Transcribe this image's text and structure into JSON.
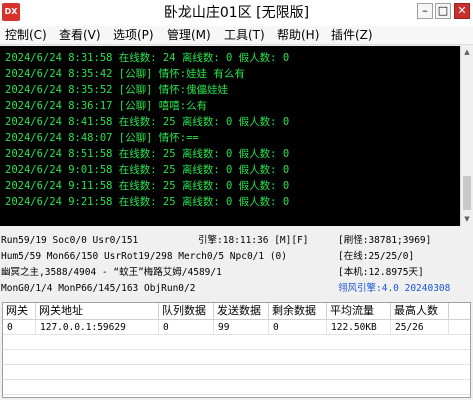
{
  "window": {
    "title": "卧龙山庄01区 [无限版]",
    "icon_label": "DX",
    "min_glyph": "–",
    "max_glyph": "□",
    "close_glyph": "✕",
    "icon": "app-logo-icon"
  },
  "menu": [
    {
      "label": "控制(C)"
    },
    {
      "label": "查看(V)"
    },
    {
      "label": "选项(P)"
    },
    {
      "label": "管理(M)"
    },
    {
      "label": "工具(T)"
    },
    {
      "label": "帮助(H)"
    },
    {
      "label": "插件(Z)"
    }
  ],
  "console": {
    "text_color": "#27e34a",
    "background": "#000000",
    "lines": [
      "2024/6/24 8:31:58 在线数: 24 离线数: 0 假人数: 0",
      "2024/6/24 8:35:42 [公聊] 情怀:娃娃 有么有",
      "2024/6/24 8:35:52 [公聊] 情怀:傀儡娃娃",
      "2024/6/24 8:36:17 [公聊] 嘻嘻:么有",
      "2024/6/24 8:41:58 在线数: 25 离线数: 0 假人数: 0",
      "2024/6/24 8:48:07 [公聊] 情怀:==",
      "2024/6/24 8:51:58 在线数: 25 离线数: 0 假人数: 0",
      "2024/6/24 9:01:58 在线数: 25 离线数: 0 假人数: 0",
      "2024/6/24 9:11:58 在线数: 25 离线数: 0 假人数: 0",
      "2024/6/24 9:21:58 在线数: 25 离线数: 0 假人数: 0"
    ]
  },
  "status": {
    "run": "Run59/19 Soc0/0 Usr0/151",
    "engine_time": "引擎:18:11:36 [M][F]",
    "refresh": "[刷怪:38781;3969]",
    "hum": "Hum5/59 Mon66/150 UsrRot19/298 Merch0/5 Npc0/1 (0)",
    "online": "[在线:25/25/0]",
    "boss": "幽冥之主,3588/4904 - “蚊王”梅路艾姆/4589/1",
    "local": "[本机:12.8975天]",
    "mon": "MonG0/1/4 MonP66/145/163 ObjRun0/2",
    "version": "翎风引擎:4.0 20240308",
    "version_color": "#1a56d6"
  },
  "gateway_table": {
    "columns": [
      "网关",
      "网关地址",
      "队列数据",
      "发送数据",
      "剩余数据",
      "平均流量",
      "最高人数"
    ],
    "rows": [
      [
        "0",
        "127.0.0.1:59629",
        "0",
        "99",
        "0",
        "122.50KB",
        "25/26"
      ]
    ]
  }
}
